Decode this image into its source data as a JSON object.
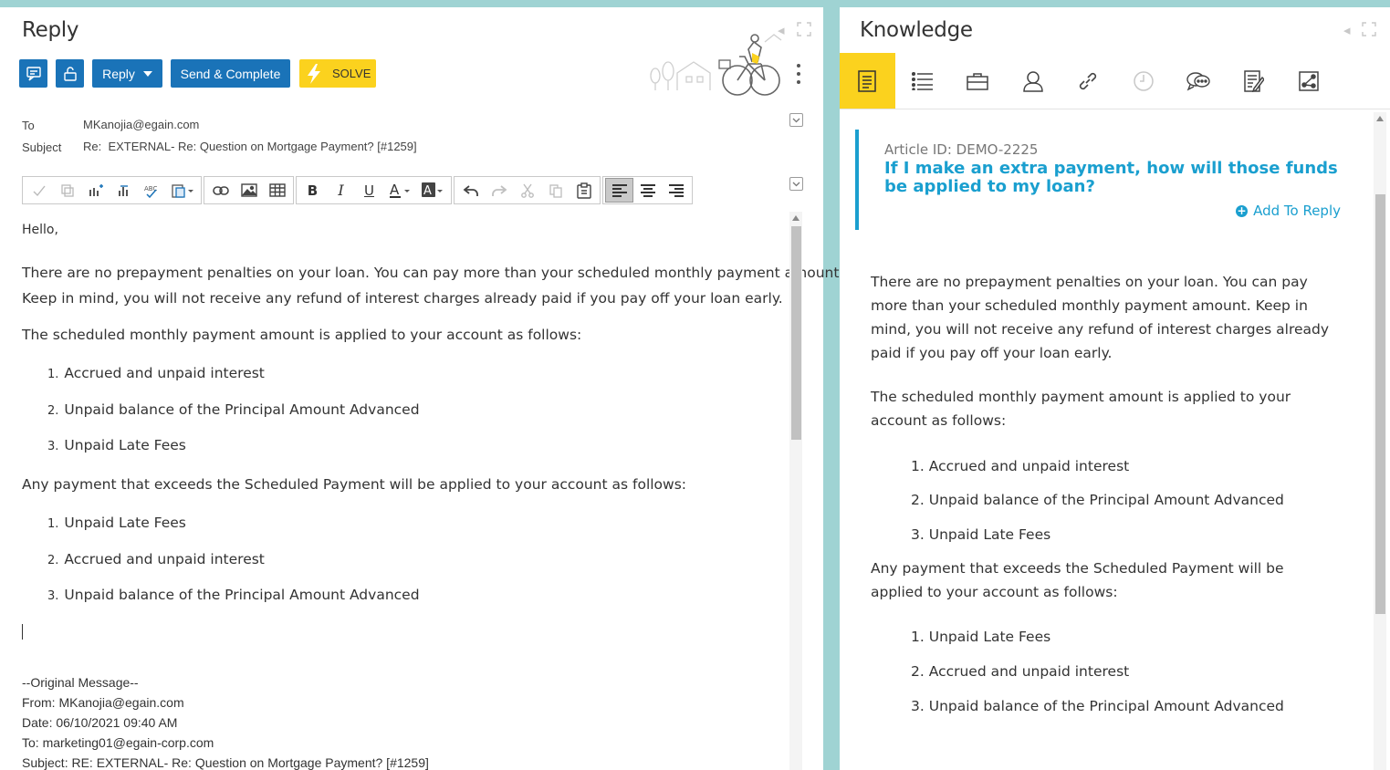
{
  "reply": {
    "title": "Reply",
    "reply_button_label": "Reply",
    "send_complete_label": "Send & Complete",
    "solve_label": "SOLVE",
    "to_label": "To",
    "to_value": "MKanojia@egain.com",
    "subject_label": "Subject",
    "subject_value": "Re:  EXTERNAL- Re: Question on Mortgage Payment? [#1259]",
    "body": {
      "greeting": "Hello,",
      "para1_line1": "There are no prepayment penalties on your loan. You can pay more than your scheduled monthly payment amount.",
      "para1_line2": "Keep in mind, you will not receive any refund of interest charges already paid if you pay off your loan early.",
      "para2": "The scheduled monthly payment amount is applied to your account as follows:",
      "list1": [
        {
          "num": "1.",
          "text": "Accrued and unpaid interest"
        },
        {
          "num": "2.",
          "text": "Unpaid balance of the Principal Amount Advanced"
        },
        {
          "num": "3.",
          "text": "Unpaid Late Fees"
        }
      ],
      "para3": "Any payment that exceeds the Scheduled Payment will be applied to your account as follows:",
      "list2": [
        {
          "num": "1.",
          "text": "Unpaid Late Fees"
        },
        {
          "num": "2.",
          "text": "Accrued and unpaid interest"
        },
        {
          "num": "3.",
          "text": "Unpaid balance of the Principal Amount Advanced"
        }
      ],
      "original_header": "--Original Message--",
      "original_from": "From: MKanojia@egain.com",
      "original_date": "Date: 06/10/2021 09:40 AM",
      "original_to": "To: marketing01@egain-corp.com",
      "original_subject": "Subject: RE: EXTERNAL- Re: Question on Mortgage Payment? [#1259]"
    }
  },
  "knowledge": {
    "title": "Knowledge",
    "tabs": [
      "article-icon",
      "list-icon",
      "briefcase-icon",
      "user-icon",
      "link-icon",
      "clock-icon",
      "chat-icon",
      "notes-icon",
      "share-icon"
    ],
    "article_id": "Article ID: DEMO-2225",
    "article_title": "If I make an extra payment, how will those funds be applied to my loan?",
    "add_to_reply": "Add To Reply",
    "body": {
      "para1": "There are no prepayment penalties on your loan. You can pay more than your scheduled monthly payment amount. Keep in mind, you will not receive any refund of interest charges already paid if you pay off your loan early.",
      "para2": "The scheduled monthly payment amount is applied to your account as follows:",
      "list1": [
        {
          "num": "1.",
          "text": "Accrued and unpaid interest"
        },
        {
          "num": "2.",
          "text": "Unpaid balance of the Principal Amount Advanced"
        },
        {
          "num": "3.",
          "text": "Unpaid Late Fees"
        }
      ],
      "para3": "Any payment that exceeds the Scheduled Payment will be applied to your account as follows:",
      "list2": [
        {
          "num": "1.",
          "text": "Unpaid Late Fees"
        },
        {
          "num": "2.",
          "text": "Accrued and unpaid interest"
        },
        {
          "num": "3.",
          "text": "Unpaid balance of the Principal Amount Advanced"
        }
      ]
    }
  },
  "colors": {
    "accent_blue": "#1a73b8",
    "solve_yellow": "#fbd21e",
    "link_blue": "#1a9fcf",
    "background_teal": "#9fd3d3"
  }
}
